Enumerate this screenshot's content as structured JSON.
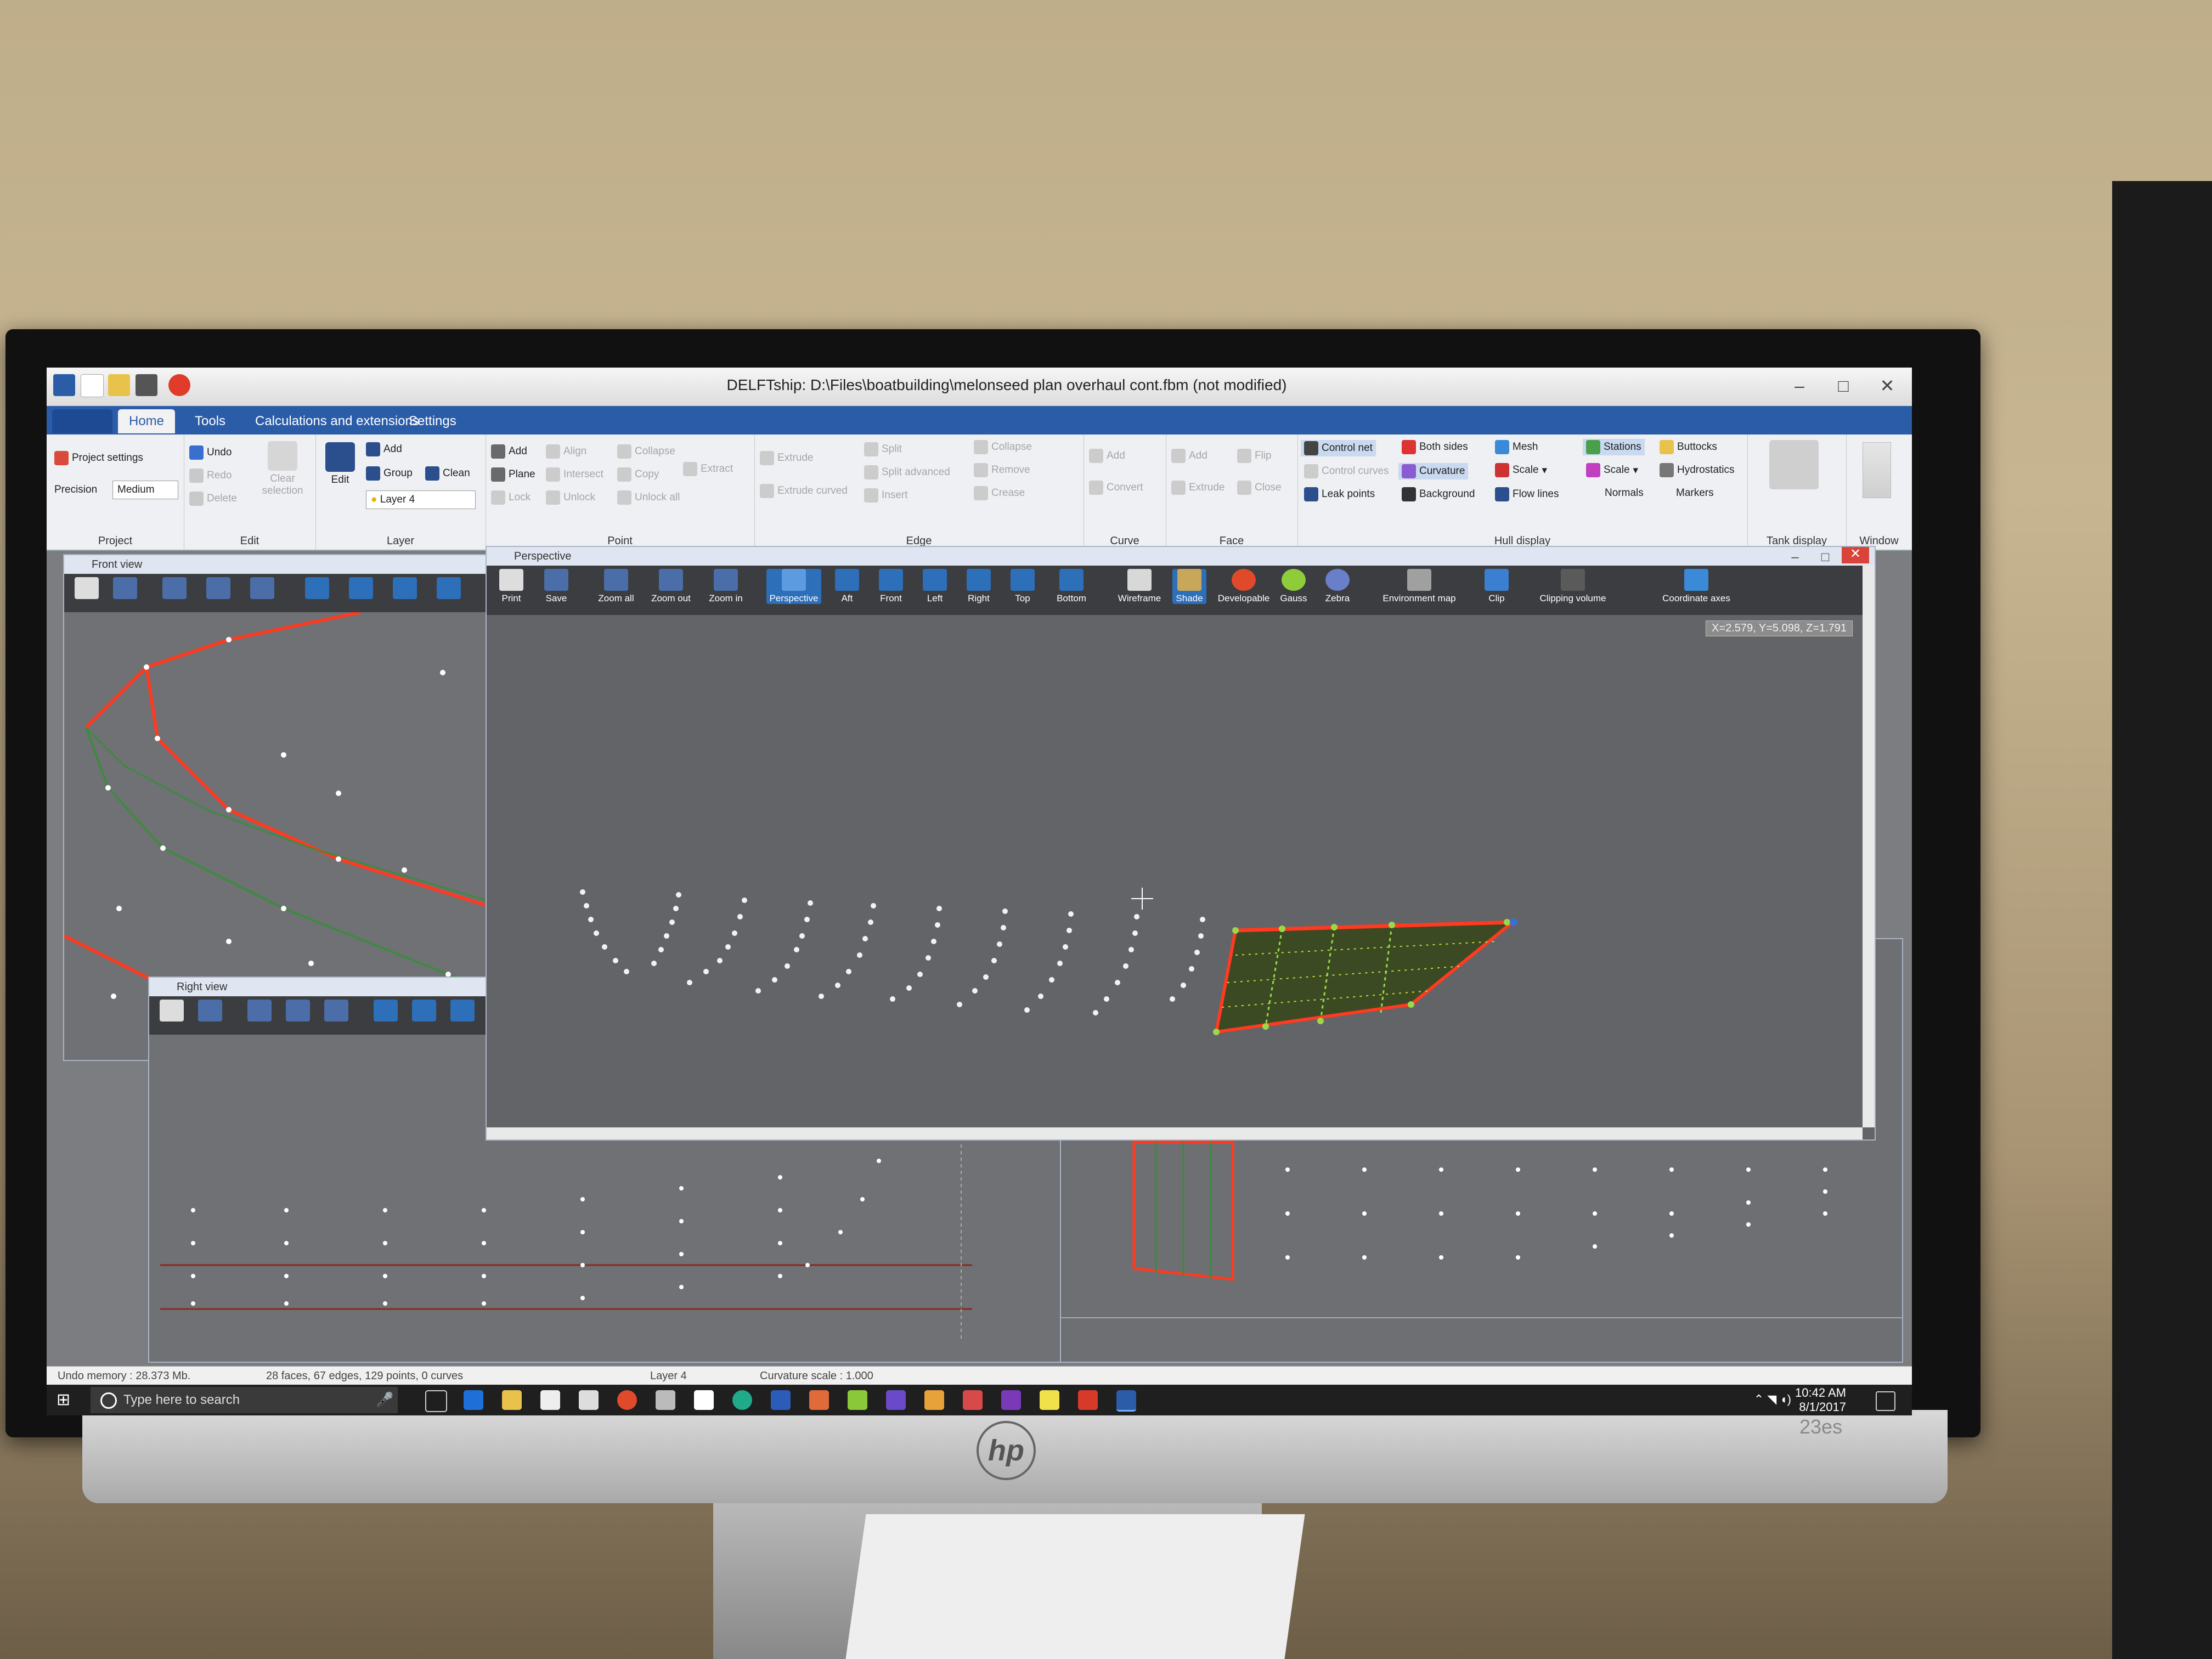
{
  "window": {
    "title": "DELFTship: D:\\Files\\boatbuilding\\melonseed plan overhaul cont.fbm (not modified)"
  },
  "tabs": [
    "Home",
    "Tools",
    "Calculations and extensions",
    "Settings"
  ],
  "ribbon": {
    "project": {
      "label": "Project",
      "settings": "Project settings",
      "precision_label": "Precision",
      "precision_value": "Medium"
    },
    "edit": {
      "label": "Edit",
      "undo": "Undo",
      "redo": "Redo",
      "delete": "Delete",
      "clear_selection": "Clear selection"
    },
    "layer": {
      "label": "Layer",
      "edit": "Edit",
      "add": "Add",
      "group": "Group",
      "clean": "Clean",
      "current": "Layer 4"
    },
    "point": {
      "label": "Point",
      "add": "Add",
      "align": "Align",
      "collapse": "Collapse",
      "plane": "Plane",
      "intersect": "Intersect",
      "copy": "Copy",
      "extract": "Extract",
      "lock": "Lock",
      "unlock": "Unlock",
      "unlock_all": "Unlock all"
    },
    "edge": {
      "label": "Edge",
      "extrude": "Extrude",
      "split": "Split",
      "collapse": "Collapse",
      "split_advanced": "Split advanced",
      "remove": "Remove",
      "extrude_curved": "Extrude curved",
      "insert": "Insert",
      "crease": "Crease"
    },
    "curve": {
      "label": "Curve",
      "add": "Add",
      "convert": "Convert"
    },
    "face": {
      "label": "Face",
      "add": "Add",
      "flip": "Flip",
      "extrude": "Extrude",
      "close": "Close"
    },
    "hull_display": {
      "label": "Hull display",
      "control_net": "Control net",
      "control_curves": "Control curves",
      "leak_points": "Leak points",
      "both_sides": "Both sides",
      "curvature": "Curvature",
      "background": "Background",
      "mesh": "Mesh",
      "scale1": "Scale",
      "flow_lines": "Flow lines",
      "stations": "Stations",
      "scale2": "Scale",
      "normals": "Normals",
      "buttocks": "Buttocks",
      "hydrostatics": "Hydrostatics",
      "markers": "Markers"
    },
    "tank_display": "Tank display",
    "window": "Window"
  },
  "viewports": {
    "front": "Front view",
    "right": "Right view",
    "perspective": "Perspective"
  },
  "perspective_toolbar": [
    "Print",
    "Save",
    "Zoom all",
    "Zoom out",
    "Zoom in",
    "Perspective",
    "Aft",
    "Front",
    "Left",
    "Right",
    "Top",
    "Bottom",
    "Wireframe",
    "Shade",
    "Developable",
    "Gauss",
    "Zebra",
    "Environment map",
    "Clip",
    "Clipping volume",
    "Coordinate axes"
  ],
  "coord_readout": "X=2.579, Y=5.098, Z=1.791",
  "status": {
    "undo_memory": "Undo memory : 28.373 Mb.",
    "counts": "28 faces, 67 edges, 129 points, 0 curves",
    "layer": "Layer 4",
    "curvature_scale": "Curvature scale : 1.000"
  },
  "taskbar": {
    "search_placeholder": "Type here to search",
    "time": "10:42 AM",
    "date": "8/1/2017"
  },
  "monitor": {
    "brand": "hp",
    "model": "23es"
  }
}
